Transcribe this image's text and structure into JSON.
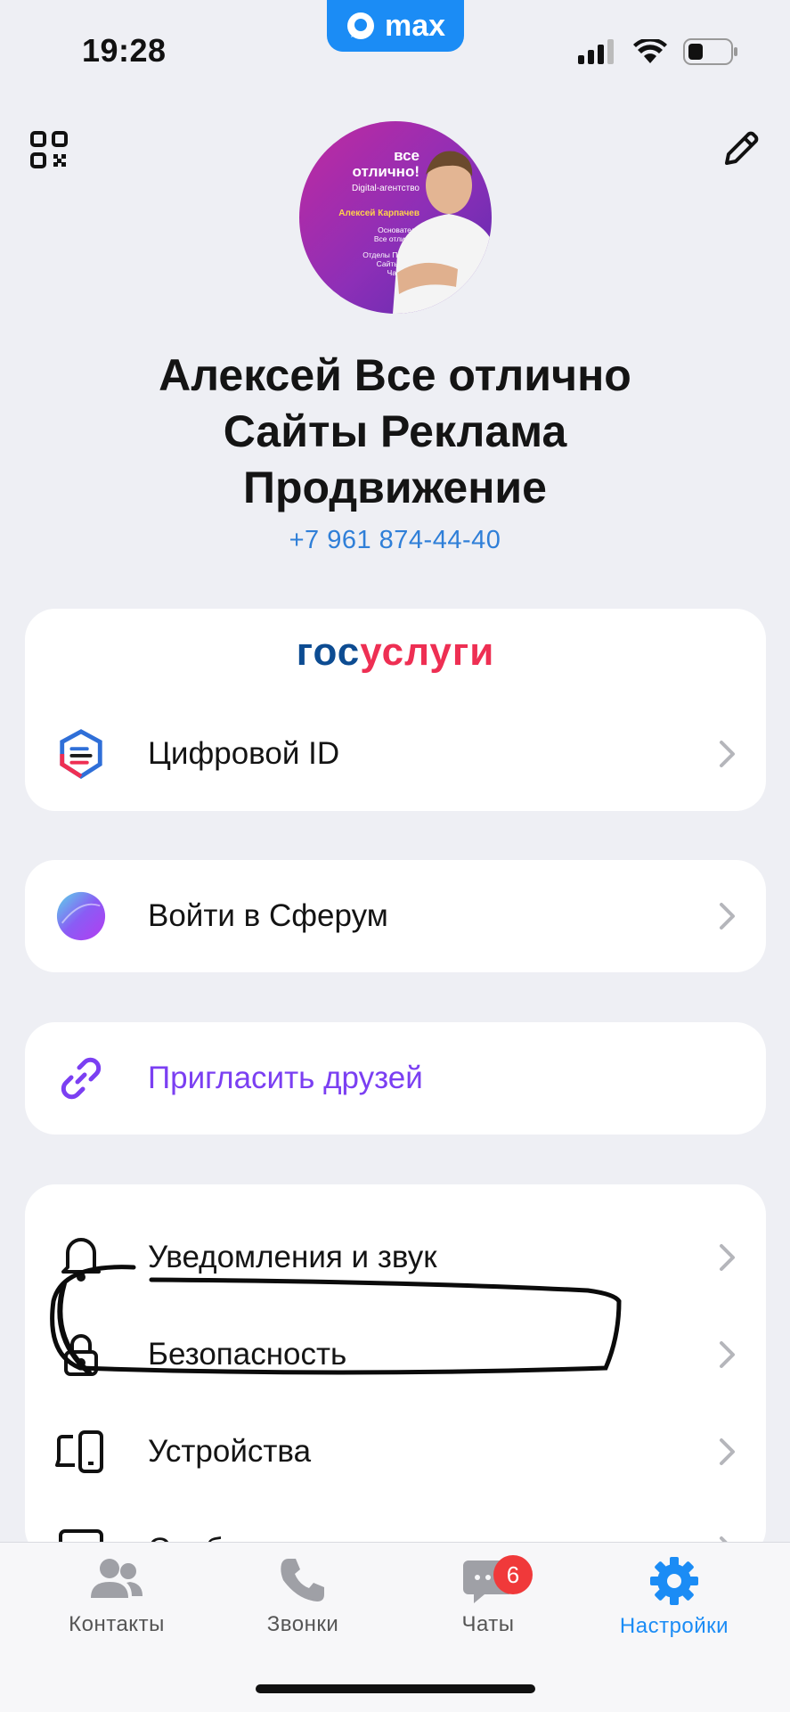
{
  "status": {
    "time": "19:28",
    "app_pill": "max"
  },
  "profile": {
    "name_lines": [
      "Алексей Все отлично",
      "Сайты Реклама",
      "Продвижение"
    ],
    "phone": "+7 961 874-44-40",
    "avatar": {
      "brand_line1": "все",
      "brand_line2": "отлично!",
      "agency": "Digital-агентство",
      "person": "Алексей Карпачев",
      "role1": "Основатель",
      "role2": "Все отлично!",
      "services": [
        "Отделы Продаж",
        "Сайты, SEO",
        "Чат-боты",
        "CRM"
      ]
    }
  },
  "gosuslugi": {
    "part1": "гос",
    "part2": "услуги",
    "item": "Цифровой ID"
  },
  "sferum": {
    "label": "Войти в Сферум"
  },
  "invite": {
    "label": "Пригласить друзей"
  },
  "settings": [
    {
      "label": "Уведомления и звук",
      "icon": "bell-icon"
    },
    {
      "label": "Безопасность",
      "icon": "lock-icon"
    },
    {
      "label": "Устройства",
      "icon": "devices-icon"
    },
    {
      "label": "Сообщения",
      "icon": "chat-bubble-icon"
    }
  ],
  "tabs": [
    {
      "label": "Контакты"
    },
    {
      "label": "Звонки"
    },
    {
      "label": "Чаты",
      "badge": "6"
    },
    {
      "label": "Настройки",
      "active": true
    }
  ],
  "colors": {
    "accent": "#1b8cf5",
    "invite": "#7b3ff2",
    "phone": "#2f7fd8",
    "gos_blue": "#0d4c92",
    "gos_red": "#ee2f53",
    "badge": "#f0393a"
  }
}
